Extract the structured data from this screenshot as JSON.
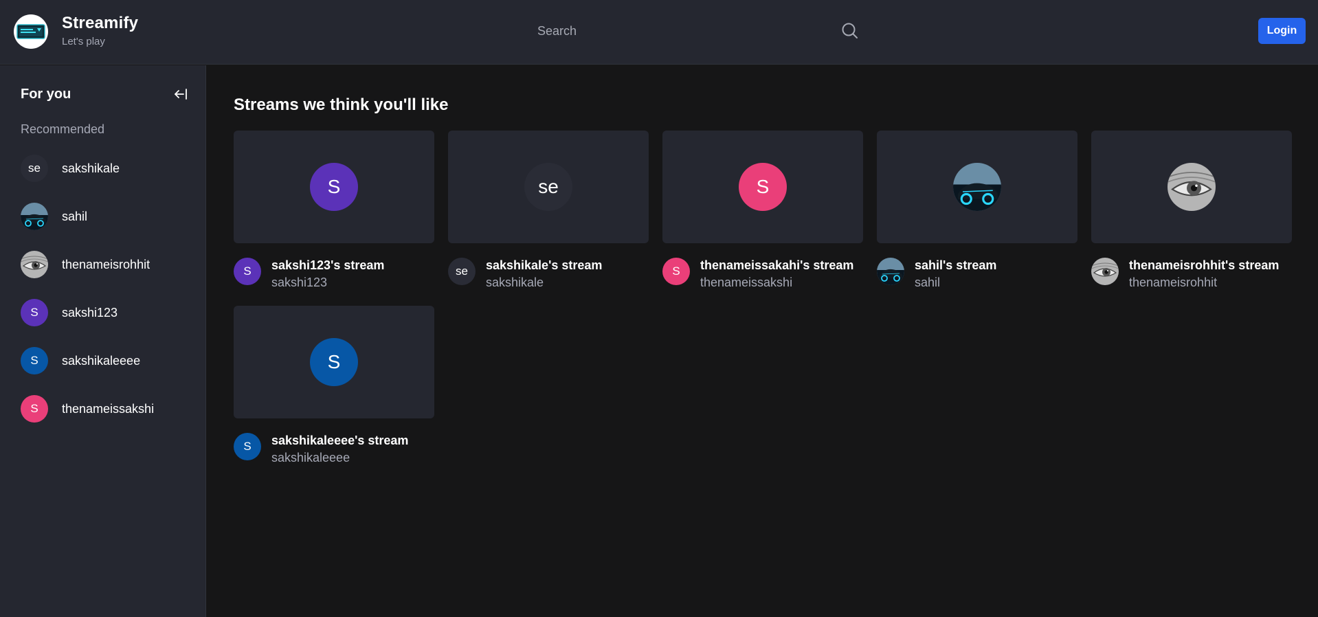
{
  "header": {
    "brand_title": "Streamify",
    "brand_subtitle": "Let's play",
    "search_placeholder": "Search",
    "login_label": "Login"
  },
  "sidebar": {
    "title": "For you",
    "recommended_label": "Recommended",
    "items": [
      {
        "name": "sakshikale",
        "initial": "se",
        "color": "#2a2c36",
        "type": "text"
      },
      {
        "name": "sahil",
        "initial": "",
        "color": "#0d1b26",
        "type": "car"
      },
      {
        "name": "thenameisrohhit",
        "initial": "",
        "color": "#8a8a8a",
        "type": "eye"
      },
      {
        "name": "sakshi123",
        "initial": "S",
        "color": "#5b32b8",
        "type": "text"
      },
      {
        "name": "sakshikaleeee",
        "initial": "S",
        "color": "#0757a6",
        "type": "text"
      },
      {
        "name": "thenameissakshi",
        "initial": "S",
        "color": "#ea3f79",
        "type": "text"
      }
    ]
  },
  "main": {
    "title": "Streams we think you'll like",
    "streams": [
      {
        "title": "sakshi123's stream",
        "user": "sakshi123",
        "initial": "S",
        "color": "#5b32b8",
        "type": "text"
      },
      {
        "title": "sakshikale's stream",
        "user": "sakshikale",
        "initial": "se",
        "color": "#2a2c36",
        "type": "text"
      },
      {
        "title": "thenameissakahi's stream",
        "user": "thenameissakshi",
        "initial": "S",
        "color": "#ea3f79",
        "type": "text"
      },
      {
        "title": "sahil's stream",
        "user": "sahil",
        "initial": "",
        "color": "#0d1b26",
        "type": "car"
      },
      {
        "title": "thenameisrohhit's stream",
        "user": "thenameisrohhit",
        "initial": "",
        "color": "#8a8a8a",
        "type": "eye"
      },
      {
        "title": "sakshikaleeee's stream",
        "user": "sakshikaleeee",
        "initial": "S",
        "color": "#0757a6",
        "type": "text"
      }
    ]
  }
}
